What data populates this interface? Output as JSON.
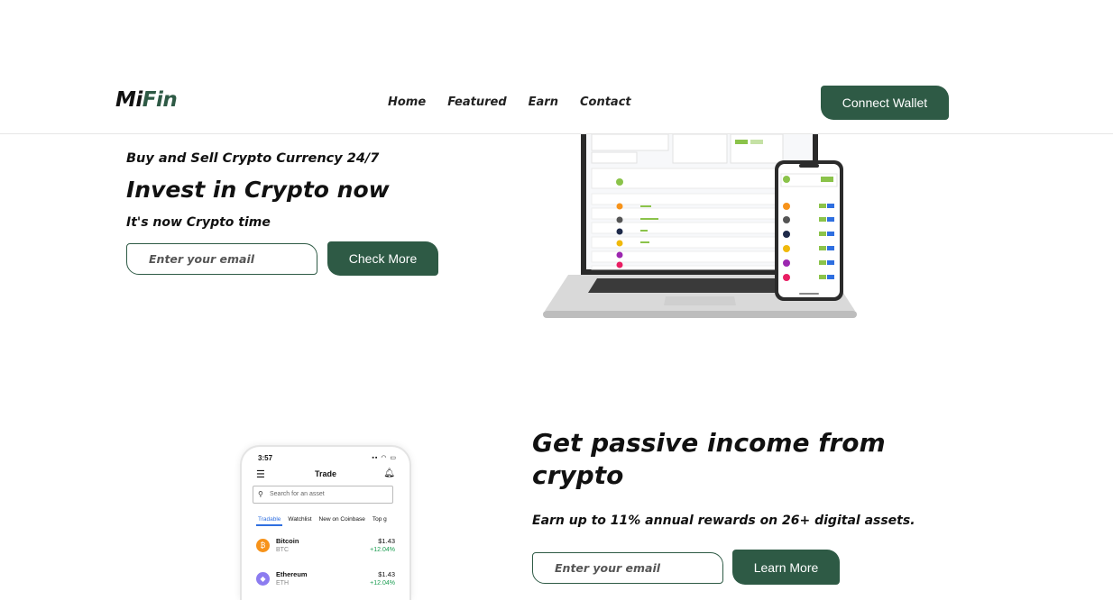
{
  "brand": {
    "logo_part1": "Mi",
    "logo_part2": "Fin"
  },
  "nav": {
    "items": [
      "Home",
      "Featured",
      "Earn",
      "Contact"
    ]
  },
  "header": {
    "connect_label": "Connect Wallet"
  },
  "hero": {
    "kicker": "Buy and Sell Crypto Currency 24/7",
    "title": "Invest in Crypto now",
    "subtitle": "It's now Crypto time",
    "email_placeholder": "Enter your email",
    "cta_label": "Check More"
  },
  "passive": {
    "title": "Get passive income from crypto",
    "subtitle": "Earn up to 11% annual rewards on 26+ digital assets.",
    "email_placeholder": "Enter your email",
    "cta_label": "Learn More"
  },
  "phone_mockup": {
    "time": "3:57",
    "title": "Trade",
    "search_placeholder": "Search for an asset",
    "tabs": [
      "Tradable",
      "Watchlist",
      "New on Coinbase",
      "Top g"
    ],
    "assets": [
      {
        "name": "Bitcoin",
        "symbol": "BTC",
        "price": "$1.43",
        "change": "+12.04%",
        "color": "#f7931a",
        "glyph": "₿"
      },
      {
        "name": "Ethereum",
        "symbol": "ETH",
        "price": "$1.43",
        "change": "+12.04%",
        "color": "#8c7cf0",
        "glyph": "◆"
      }
    ]
  },
  "colors": {
    "brand_green": "#2e5a45",
    "accent_blue": "#2f6fe0",
    "positive": "#1a9c50"
  }
}
